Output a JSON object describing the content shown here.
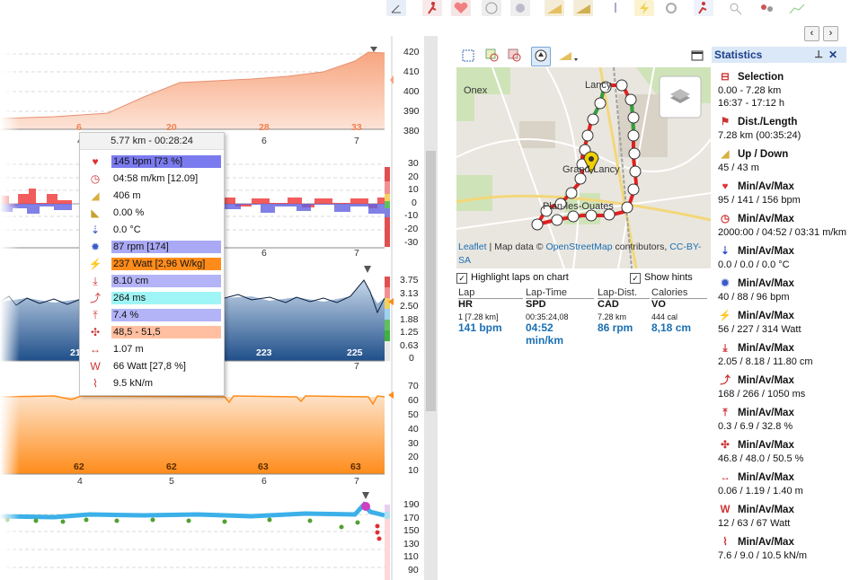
{
  "toolbar": {
    "icons": [
      "chart-type-icon",
      "runner-icon",
      "heart-icon",
      "pace-icon",
      "cadence-icon",
      "elevation-icon",
      "slope-icon",
      "temperature-icon",
      "power-icon",
      "settings-icon",
      "runner-options-icon",
      "zoom-icon",
      "export-icon",
      "chart-icon"
    ]
  },
  "charts": {
    "elevation": {
      "yticks": [
        "420",
        "410",
        "400",
        "390",
        "380"
      ],
      "markers": [
        "6",
        "20",
        "28",
        "33"
      ]
    },
    "x_ticks": [
      "4",
      "5",
      "6",
      "7"
    ],
    "heartrate": {
      "yticks": [
        "30",
        "20",
        "10",
        "0",
        "-10",
        "-20",
        "-30"
      ]
    },
    "stride": {
      "yticks": [
        "3.75",
        "3.13",
        "2.50",
        "1.88",
        "1.25",
        "0.63",
        "0"
      ],
      "markers": [
        "21",
        "223",
        "225"
      ]
    },
    "cadence": {
      "yticks": [
        "70",
        "60",
        "50",
        "40",
        "30",
        "20",
        "10"
      ],
      "markers": [
        "62",
        "62",
        "63",
        "63"
      ]
    },
    "vo": {
      "yticks": [
        "190",
        "170",
        "150",
        "130",
        "110",
        "90"
      ]
    }
  },
  "tooltip": {
    "header": "5.77 km - 00:28:24",
    "rows": [
      {
        "icon": "heart-icon",
        "text": "145 bpm [73 %]",
        "bg": "#7b7bf0"
      },
      {
        "icon": "pace-icon",
        "text": "04:58 m/km [12.09]",
        "bg": ""
      },
      {
        "icon": "elevation-icon",
        "text": "406 m",
        "bg": ""
      },
      {
        "icon": "slope-icon",
        "text": "0.00 %",
        "bg": ""
      },
      {
        "icon": "temperature-icon",
        "text": "0.0 °C",
        "bg": ""
      },
      {
        "icon": "cadence-icon",
        "text": "87 rpm [174]",
        "bg": "#a9a9f5"
      },
      {
        "icon": "power-icon",
        "text": "237 Watt [2,96 W/kg]",
        "bg": "#ff8c1a"
      },
      {
        "icon": "stride-icon",
        "text": "8.10 cm",
        "bg": "#b3b3f7"
      },
      {
        "icon": "ground-contact-icon",
        "text": "264 ms",
        "bg": "#9ff5f5"
      },
      {
        "icon": "vertical-ratio-icon",
        "text": "7.4 %",
        "bg": "#b3b3f7"
      },
      {
        "icon": "balance-icon",
        "text": "48,5 - 51,5",
        "bg": "#ffbfa0"
      },
      {
        "icon": "stride-length-icon",
        "text": "1.07 m",
        "bg": ""
      },
      {
        "icon": "form-power-icon",
        "text": "66 Watt [27,8 %]",
        "bg": ""
      },
      {
        "icon": "leg-spring-icon",
        "text": "9.5 kN/m",
        "bg": ""
      }
    ]
  },
  "map": {
    "places": [
      "Onex",
      "Lancy",
      "Grand-Lancy",
      "Plan-les-Ouates"
    ],
    "attribution": {
      "leaflet": "Leaflet",
      "sep": " | Map data © ",
      "osm": "OpenStreetMap",
      "contrib": " contributors, ",
      "cc": "CC-BY-SA"
    }
  },
  "options": {
    "highlight_laps": "Highlight laps on chart",
    "show_hints": "Show hints"
  },
  "laps": {
    "columns": [
      {
        "h1": "Lap",
        "h2": "HR",
        "s": "1  [7.28 km]",
        "v": "141 bpm"
      },
      {
        "h1": "Lap-Time",
        "h2": "SPD",
        "s": "00:35:24,08",
        "v": "04:52 min/km"
      },
      {
        "h1": "Lap-Dist.",
        "h2": "CAD",
        "s": "7.28 km",
        "v": "86 rpm"
      },
      {
        "h1": "Calories",
        "h2": "VO",
        "s": "444 cal",
        "v": "8,18 cm"
      }
    ]
  },
  "stats": {
    "title": "Statistics",
    "blocks": [
      {
        "icon": "selection-icon",
        "head": "Selection",
        "vals": [
          "0.00 - 7.28 km",
          "16:37 - 17:12 h"
        ]
      },
      {
        "icon": "distance-icon",
        "head": "Dist./Length",
        "vals": [
          "7.28 km (00:35:24)"
        ]
      },
      {
        "icon": "elevation-icon",
        "head": "Up / Down",
        "vals": [
          "45 / 43 m"
        ]
      },
      {
        "icon": "heart-icon",
        "head": "Min/Av/Max",
        "vals": [
          "95 / 141 / 156 bpm"
        ]
      },
      {
        "icon": "pace-icon",
        "head": "Min/Av/Max",
        "vals": [
          "2000:00 / 04:52 / 03:31 m/km"
        ]
      },
      {
        "icon": "temperature-icon",
        "head": "Min/Av/Max",
        "vals": [
          "0.0 / 0.0 / 0.0 °C"
        ]
      },
      {
        "icon": "cadence-icon",
        "head": "Min/Av/Max",
        "vals": [
          "40 / 88 / 96 bpm"
        ]
      },
      {
        "icon": "power-icon",
        "head": "Min/Av/Max",
        "vals": [
          "56 / 227 / 314 Watt"
        ]
      },
      {
        "icon": "stride-icon",
        "head": "Min/Av/Max",
        "vals": [
          "2.05 / 8.18 / 11.80 cm"
        ]
      },
      {
        "icon": "ground-contact-icon",
        "head": "Min/Av/Max",
        "vals": [
          "168 / 266 / 1050 ms"
        ]
      },
      {
        "icon": "vertical-ratio-icon",
        "head": "Min/Av/Max",
        "vals": [
          "0.3 / 6.9 / 32.8 %"
        ]
      },
      {
        "icon": "balance-icon",
        "head": "Min/Av/Max",
        "vals": [
          "46.8 / 48.0 / 50.5 %"
        ]
      },
      {
        "icon": "stride-length-icon",
        "head": "Min/Av/Max",
        "vals": [
          "0.06 / 1.19 / 1.40 m"
        ]
      },
      {
        "icon": "form-power-icon",
        "head": "Min/Av/Max",
        "vals": [
          "12 / 63 / 67 Watt"
        ]
      },
      {
        "icon": "leg-spring-icon",
        "head": "Min/Av/Max",
        "vals": [
          "7.6 / 9.0 / 10.5 kN/m"
        ]
      }
    ]
  },
  "colors": {
    "elevation": "#f7a57f",
    "hr_pos": "#f04040",
    "hr_neg": "#6060e0",
    "stride": "#1f4f8a",
    "cadence": "#ff8c1a",
    "route": "#e02020",
    "accent": "#1a6fb3"
  }
}
